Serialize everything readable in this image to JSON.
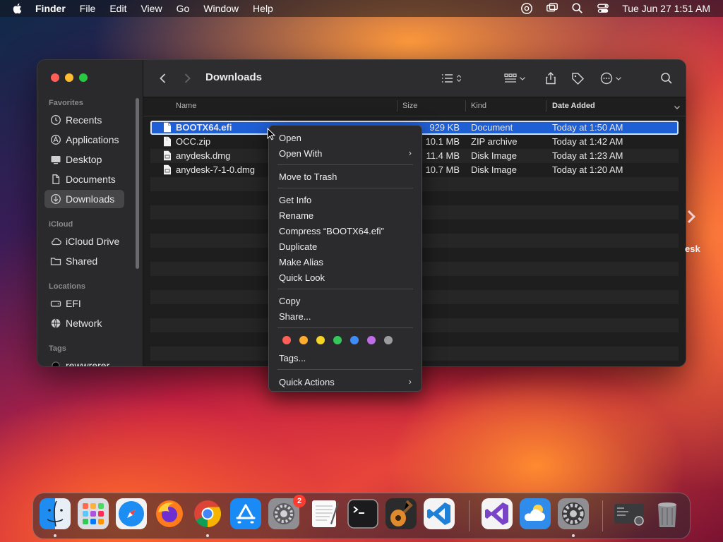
{
  "menubar": {
    "app_name": "Finder",
    "items": [
      "File",
      "Edit",
      "View",
      "Go",
      "Window",
      "Help"
    ],
    "clock": "Tue Jun 27  1:51 AM",
    "status_icons": [
      "screen-share-icon",
      "display-mirroring-icon",
      "spotlight-icon",
      "control-center-icon"
    ]
  },
  "finder": {
    "title": "Downloads",
    "sidebar": {
      "sections": {
        "favorites": "Favorites",
        "icloud": "iCloud",
        "locations": "Locations",
        "tags": "Tags"
      },
      "favorites": [
        {
          "label": "Recents",
          "icon": "clock-icon"
        },
        {
          "label": "Applications",
          "icon": "applications-icon"
        },
        {
          "label": "Desktop",
          "icon": "desktop-icon"
        },
        {
          "label": "Documents",
          "icon": "document-icon"
        },
        {
          "label": "Downloads",
          "icon": "download-icon",
          "active": true
        }
      ],
      "icloud": [
        {
          "label": "iCloud Drive",
          "icon": "cloud-icon"
        },
        {
          "label": "Shared",
          "icon": "shared-folder-icon"
        }
      ],
      "locations": [
        {
          "label": "EFI",
          "icon": "disk-icon"
        },
        {
          "label": "Network",
          "icon": "globe-icon"
        }
      ],
      "tags": [
        {
          "label": "rewwrerer",
          "color": "#000000"
        }
      ]
    },
    "columns": {
      "name": "Name",
      "size": "Size",
      "kind": "Kind",
      "date": "Date Added"
    },
    "files": [
      {
        "name": "BOOTX64.efi",
        "size": "929 KB",
        "kind": "Document",
        "date": "Today at 1:50 AM",
        "selected": true
      },
      {
        "name": "OCC.zip",
        "size": "10.1 MB",
        "kind": "ZIP archive",
        "date": "Today at 1:42 AM"
      },
      {
        "name": "anydesk.dmg",
        "size": "11.4 MB",
        "kind": "Disk Image",
        "date": "Today at 1:23 AM"
      },
      {
        "name": "anydesk-7-1-0.dmg",
        "size": "10.7 MB",
        "kind": "Disk Image",
        "date": "Today at 1:20 AM"
      }
    ]
  },
  "context_menu": {
    "open": "Open",
    "open_with": "Open With",
    "move_to_trash": "Move to Trash",
    "get_info": "Get Info",
    "rename": "Rename",
    "compress": "Compress “BOOTX64.efi”",
    "duplicate": "Duplicate",
    "make_alias": "Make Alias",
    "quick_look": "Quick Look",
    "copy": "Copy",
    "share": "Share...",
    "tag_colors": [
      "#ff5f57",
      "#ffab2e",
      "#f5d327",
      "#34c759",
      "#3e8cf7",
      "#bf6de6",
      "#9c9c9f"
    ],
    "tags": "Tags...",
    "quick_actions": "Quick Actions",
    "submenu_glyph": "›"
  },
  "desktop": {
    "partial_label": "esk"
  },
  "dock": {
    "badge_count": "2",
    "apps": [
      "finder-icon",
      "launchpad-icon",
      "safari-icon",
      "firefox-icon",
      "chrome-icon",
      "app-store-icon",
      "system-preferences-icon",
      "textedit-icon",
      "terminal-icon",
      "garageband-icon",
      "vscode-icon",
      "visual-studio-icon",
      "weather-icon",
      "system-settings-icon",
      "screenshot-icon",
      "trash-icon"
    ]
  },
  "colors": {
    "selection": "#1f5fd6",
    "window_bg": "#1e1e1e",
    "sidebar_bg": "#2a2a2c",
    "menu_bg": "#2b2b2d"
  }
}
